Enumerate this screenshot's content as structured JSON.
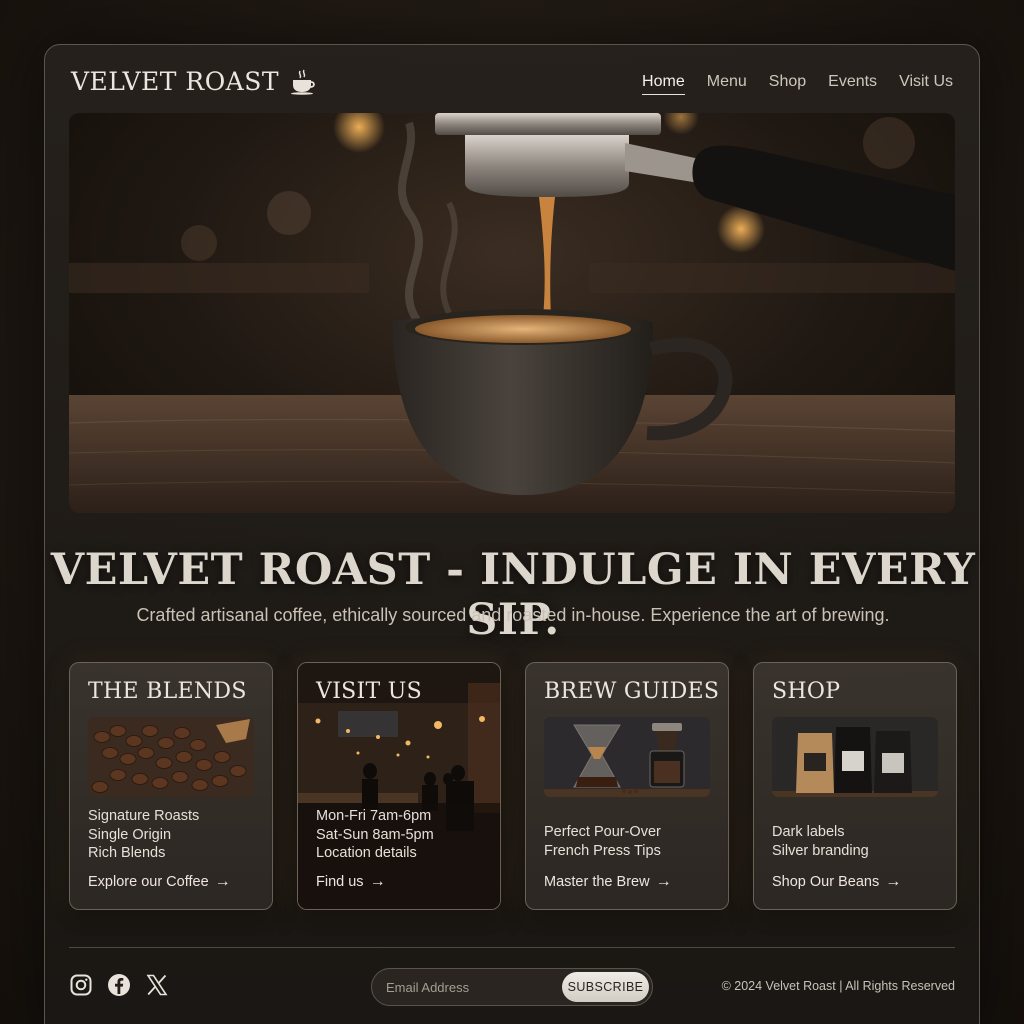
{
  "header": {
    "brand": "VELVET ROAST",
    "nav": [
      {
        "label": "Home",
        "active": true
      },
      {
        "label": "Menu",
        "active": false
      },
      {
        "label": "Shop",
        "active": false
      },
      {
        "label": "Events",
        "active": false
      },
      {
        "label": "Visit Us",
        "active": false
      }
    ]
  },
  "hero": {
    "headline": "VELVET ROAST - INDULGE IN EVERY SIP.",
    "subline": "Crafted artisanal coffee, ethically sourced and roasted in-house. Experience the art of brewing."
  },
  "cards": [
    {
      "title": "THE BLENDS",
      "lines": [
        "Signature Roasts",
        "Single Origin",
        "Rich Blends"
      ],
      "link": "Explore our Coffee"
    },
    {
      "title": "VISIT US",
      "lines": [
        "Mon-Fri 7am-6pm",
        "Sat-Sun 8am-5pm",
        "Location details"
      ],
      "link": "Find us"
    },
    {
      "title": "BREW GUIDES",
      "lines": [
        "Perfect Pour-Over",
        "French Press Tips"
      ],
      "link": "Master the Brew"
    },
    {
      "title": "SHOP",
      "lines": [
        "Dark labels",
        "Silver branding"
      ],
      "link": "Shop Our Beans"
    }
  ],
  "footer": {
    "social_icons": [
      "instagram-icon",
      "facebook-icon",
      "x-icon"
    ],
    "email_placeholder": "Email Address",
    "subscribe_label": "SUBSCRIBE",
    "copyright": "© 2024 Velvet Roast | All Rights Reserved"
  },
  "colors": {
    "background": "#1e1a16",
    "accent_amber": "#c98c3c",
    "text": "#ece6de"
  }
}
